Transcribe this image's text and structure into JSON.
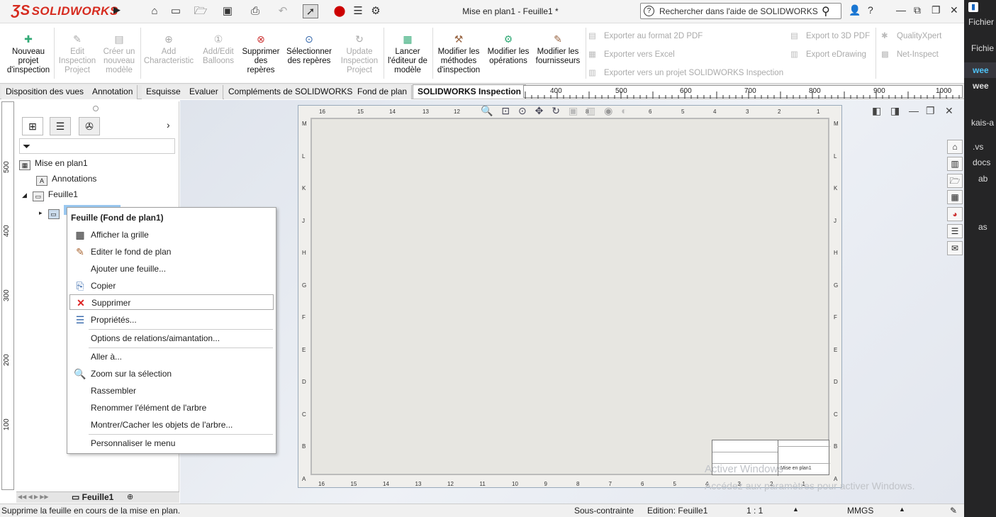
{
  "app": {
    "logo_text": "SOLIDWORKS",
    "doc_title": "Mise en plan1 - Feuille1 *"
  },
  "search": {
    "placeholder": "Rechercher dans l'aide de SOLIDWORKS"
  },
  "ribbon": {
    "buttons": [
      {
        "label": "Nouveau projet d'inspection",
        "enabled": true
      },
      {
        "label": "Edit Inspection Project",
        "enabled": false
      },
      {
        "label": "Créer un nouveau modèle",
        "enabled": false
      },
      {
        "label": "Add Characteristic",
        "enabled": false
      },
      {
        "label": "Add/Edit Balloons",
        "enabled": false
      },
      {
        "label": "Supprimer des repères",
        "enabled": true
      },
      {
        "label": "Sélectionner des repères",
        "enabled": true
      },
      {
        "label": "Update Inspection Project",
        "enabled": false
      },
      {
        "label": "Lancer l'éditeur de modèle",
        "enabled": true
      },
      {
        "label": "Modifier les méthodes d'inspection",
        "enabled": true
      },
      {
        "label": "Modifier les opérations",
        "enabled": true
      },
      {
        "label": "Modifier les fournisseurs",
        "enabled": true
      }
    ],
    "export_2d_pdf": "Exporter au format 2D PDF",
    "export_excel": "Exporter vers Excel",
    "export_sw_inspection": "Exporter vers un projet SOLIDWORKS Inspection",
    "export_3d_pdf": "Export to 3D PDF",
    "export_edrawing": "Export eDrawing",
    "qualityxpert": "QualityXpert",
    "net_inspect": "Net-Inspect"
  },
  "tabs": [
    "Disposition des vues",
    "Annotation",
    "Esquisse",
    "Evaluer",
    "Compléments de SOLIDWORKS",
    "Fond de plan",
    "SOLIDWORKS Inspection"
  ],
  "active_tab": "SOLIDWORKS Inspection",
  "hruler_ticks": [
    "400",
    "500",
    "600",
    "700",
    "800",
    "900",
    "1000"
  ],
  "vruler_ticks": [
    "500",
    "400",
    "300",
    "200",
    "100"
  ],
  "tree": {
    "root": "Mise en plan1",
    "annotations": "Annotations",
    "sheet": "Feuille1"
  },
  "sheet_tab": "Feuille1",
  "context_menu": {
    "header": "Feuille (Fond de plan1)",
    "items": [
      "Afficher la grille",
      "Editer le fond de plan",
      "Ajouter une feuille...",
      "Copier",
      "Supprimer",
      "Propriétés...",
      "Options de relations/aimantation...",
      "Aller à...",
      "Zoom sur la sélection",
      "Rassembler",
      "Renommer l'élément de l'arbre",
      "Montrer/Cacher les objets de l'arbre...",
      "Personnaliser le menu"
    ]
  },
  "sheet_top_labels": [
    "16",
    "15",
    "14",
    "13",
    "12",
    "8",
    "6",
    "5",
    "4",
    "3",
    "2",
    "1"
  ],
  "sheet_bottom_labels": [
    "16",
    "15",
    "14",
    "13",
    "12",
    "11",
    "10",
    "9",
    "8",
    "7",
    "6",
    "5",
    "4",
    "3",
    "2",
    "1"
  ],
  "sheet_side_labels": [
    "M",
    "L",
    "K",
    "J",
    "H",
    "G",
    "F",
    "E",
    "D",
    "C",
    "B",
    "A"
  ],
  "titleblock_text": "Mise en plan1",
  "watermark": {
    "line1": "Activer Windows",
    "line2": "Accédez aux paramètres pour activer Windows."
  },
  "status": {
    "message": "Supprime la feuille en cours de la mise en plan.",
    "constraint": "Sous-contrainte",
    "edition": "Edition: Feuille1",
    "scale": "1 : 1",
    "units": "MMGS"
  },
  "right_pane": [
    "Fichier",
    "Fichie",
    "wee",
    "wee",
    "kais-a",
    ".vs",
    "docs",
    "ab",
    "as"
  ]
}
